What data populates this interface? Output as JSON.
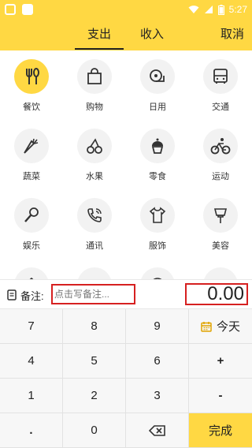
{
  "status_bar": {
    "time": "5:27"
  },
  "header": {
    "tabs": [
      {
        "label": "支出",
        "active": true
      },
      {
        "label": "收入",
        "active": false
      }
    ],
    "cancel_label": "取消"
  },
  "categories": [
    {
      "label": "餐饮",
      "icon": "fork-spoon-icon",
      "active": true
    },
    {
      "label": "购物",
      "icon": "shopping-bag-icon",
      "active": false
    },
    {
      "label": "日用",
      "icon": "tissue-roll-icon",
      "active": false
    },
    {
      "label": "交通",
      "icon": "bus-icon",
      "active": false
    },
    {
      "label": "蔬菜",
      "icon": "carrot-icon",
      "active": false
    },
    {
      "label": "水果",
      "icon": "cherries-icon",
      "active": false
    },
    {
      "label": "零食",
      "icon": "cupcake-icon",
      "active": false
    },
    {
      "label": "运动",
      "icon": "cyclist-icon",
      "active": false
    },
    {
      "label": "娱乐",
      "icon": "microphone-icon",
      "active": false
    },
    {
      "label": "通讯",
      "icon": "phone-icon",
      "active": false
    },
    {
      "label": "服饰",
      "icon": "tshirt-icon",
      "active": false
    },
    {
      "label": "美容",
      "icon": "brush-icon",
      "active": false
    },
    {
      "label": "",
      "icon": "house-icon",
      "active": false
    },
    {
      "label": "",
      "icon": "car-icon",
      "active": false
    },
    {
      "label": "",
      "icon": "baby-icon",
      "active": false
    },
    {
      "label": "",
      "icon": "shopping-cart-icon",
      "active": false
    }
  ],
  "note": {
    "label": "备注:",
    "placeholder": "点击写备注..."
  },
  "amount": "0.00",
  "keypad": {
    "rows": [
      [
        "7",
        "8",
        "9",
        "今天"
      ],
      [
        "4",
        "5",
        "6",
        "+"
      ],
      [
        "1",
        "2",
        "3",
        "-"
      ],
      [
        ".",
        "0",
        "⌫",
        "完成"
      ]
    ]
  },
  "colors": {
    "accent": "#ffd843",
    "highlight_border": "#d62020"
  }
}
